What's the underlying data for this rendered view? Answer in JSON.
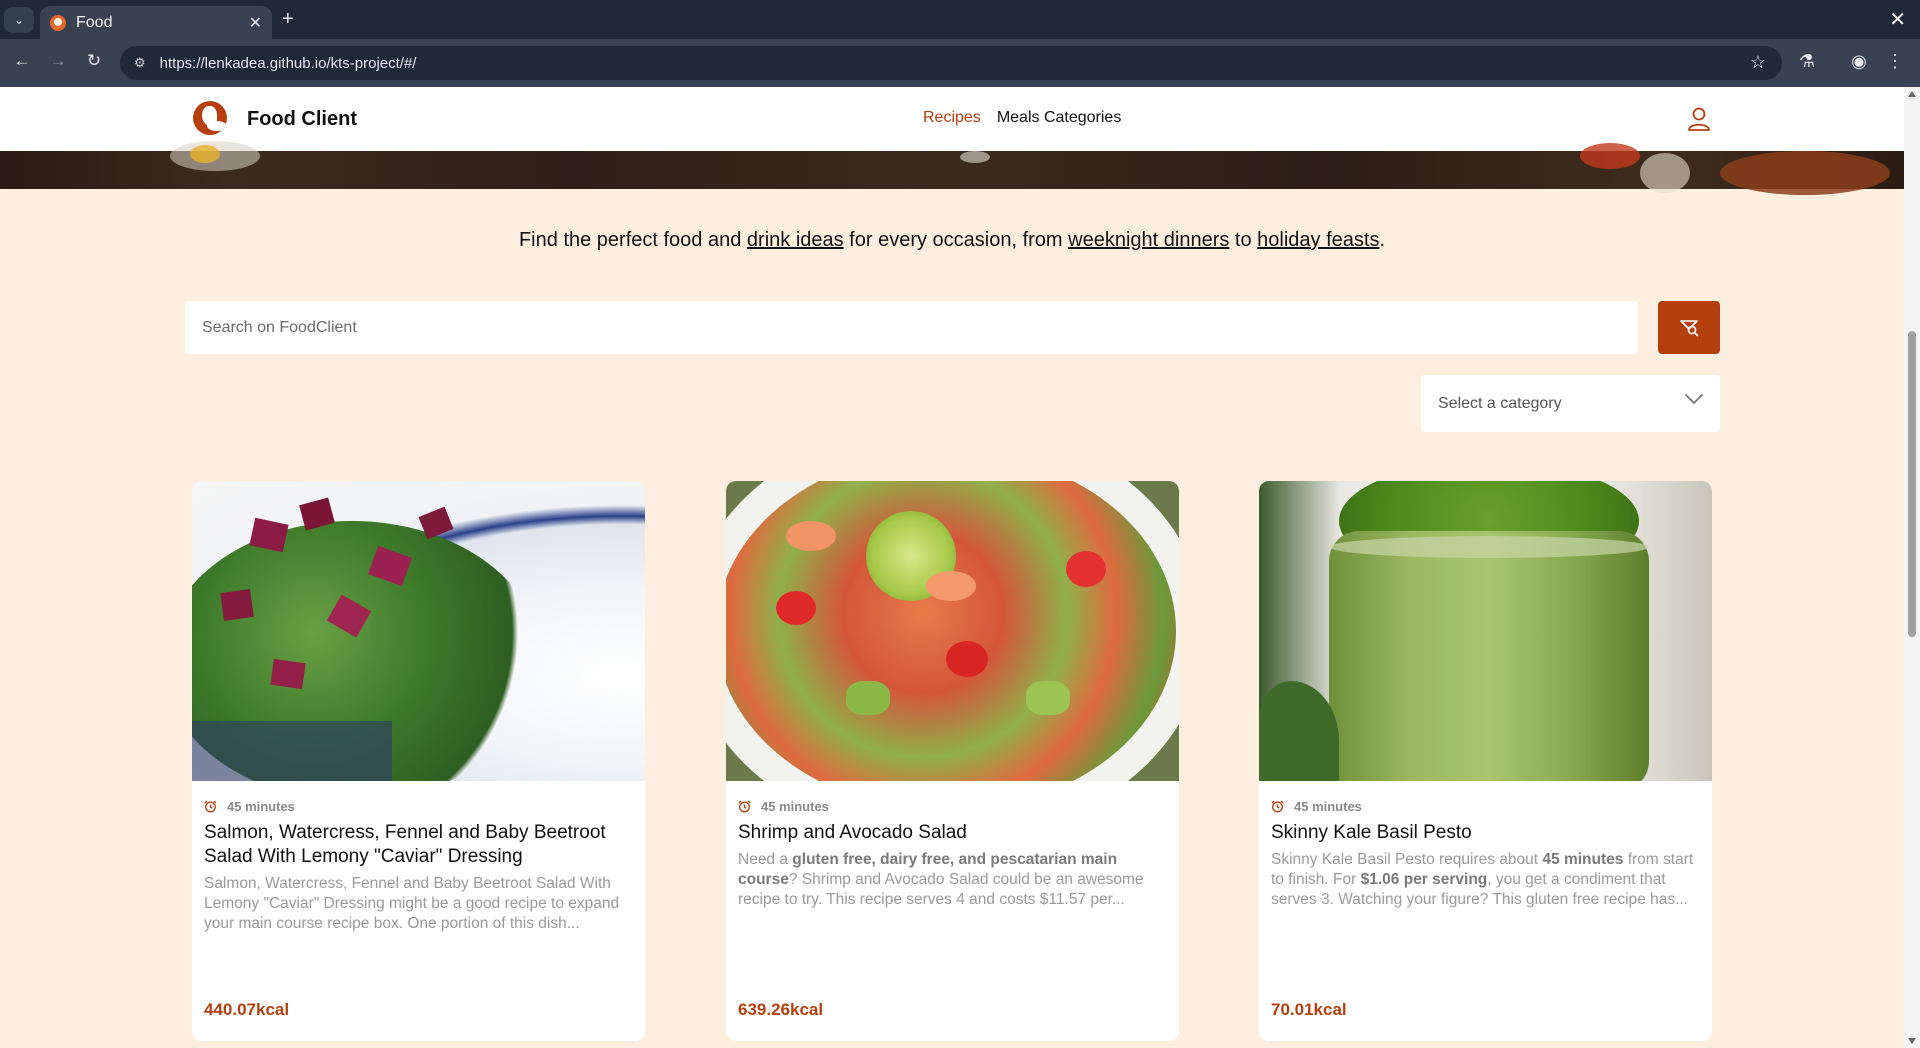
{
  "browser": {
    "tab_title": "Food",
    "url": "https://lenkadea.github.io/kts-project/#/"
  },
  "header": {
    "brand": "Food Client",
    "nav": {
      "recipes": "Recipes",
      "categories": "Meals Categories"
    }
  },
  "tagline": {
    "part1": "Find the perfect food and ",
    "link1": "drink ideas",
    "part2": " for every occasion, from ",
    "link2": "weeknight dinners",
    "part3": " to ",
    "link3": "holiday feasts",
    "part4": "."
  },
  "search": {
    "placeholder": "Search on FoodClient"
  },
  "category": {
    "placeholder": "Select a category"
  },
  "recipes": [
    {
      "time": "45 minutes",
      "title": "Salmon, Watercress, Fennel and Baby Beetroot Salad With Lemony \"Caviar\" Dressing",
      "desc": "Salmon, Watercress, Fennel and Baby Beetroot Salad With Lemony \"Caviar\" Dressing might be a good recipe to expand your main course recipe box. One portion of this dish...",
      "kcal": "440.07kcal"
    },
    {
      "time": "45 minutes",
      "title": "Shrimp and Avocado Salad",
      "desc_a": "Need a ",
      "desc_b": "gluten free, dairy free, and pescatarian main course",
      "desc_c": "? Shrimp and Avocado Salad could be an awesome recipe to try. This recipe serves 4 and costs $11.57 per...",
      "kcal": "639.26kcal"
    },
    {
      "time": "45 minutes",
      "title": "Skinny Kale Basil Pesto",
      "desc_a": "Skinny Kale Basil Pesto requires about ",
      "desc_b": "45 minutes",
      "desc_c": " from start to finish. For ",
      "desc_d": "$1.06 per serving",
      "desc_e": ", you get a condiment that serves 3. Watching your figure? This gluten free recipe has...",
      "kcal": "70.01kcal"
    }
  ],
  "colors": {
    "accent": "#b5400e",
    "page_bg": "#fdefe0"
  }
}
